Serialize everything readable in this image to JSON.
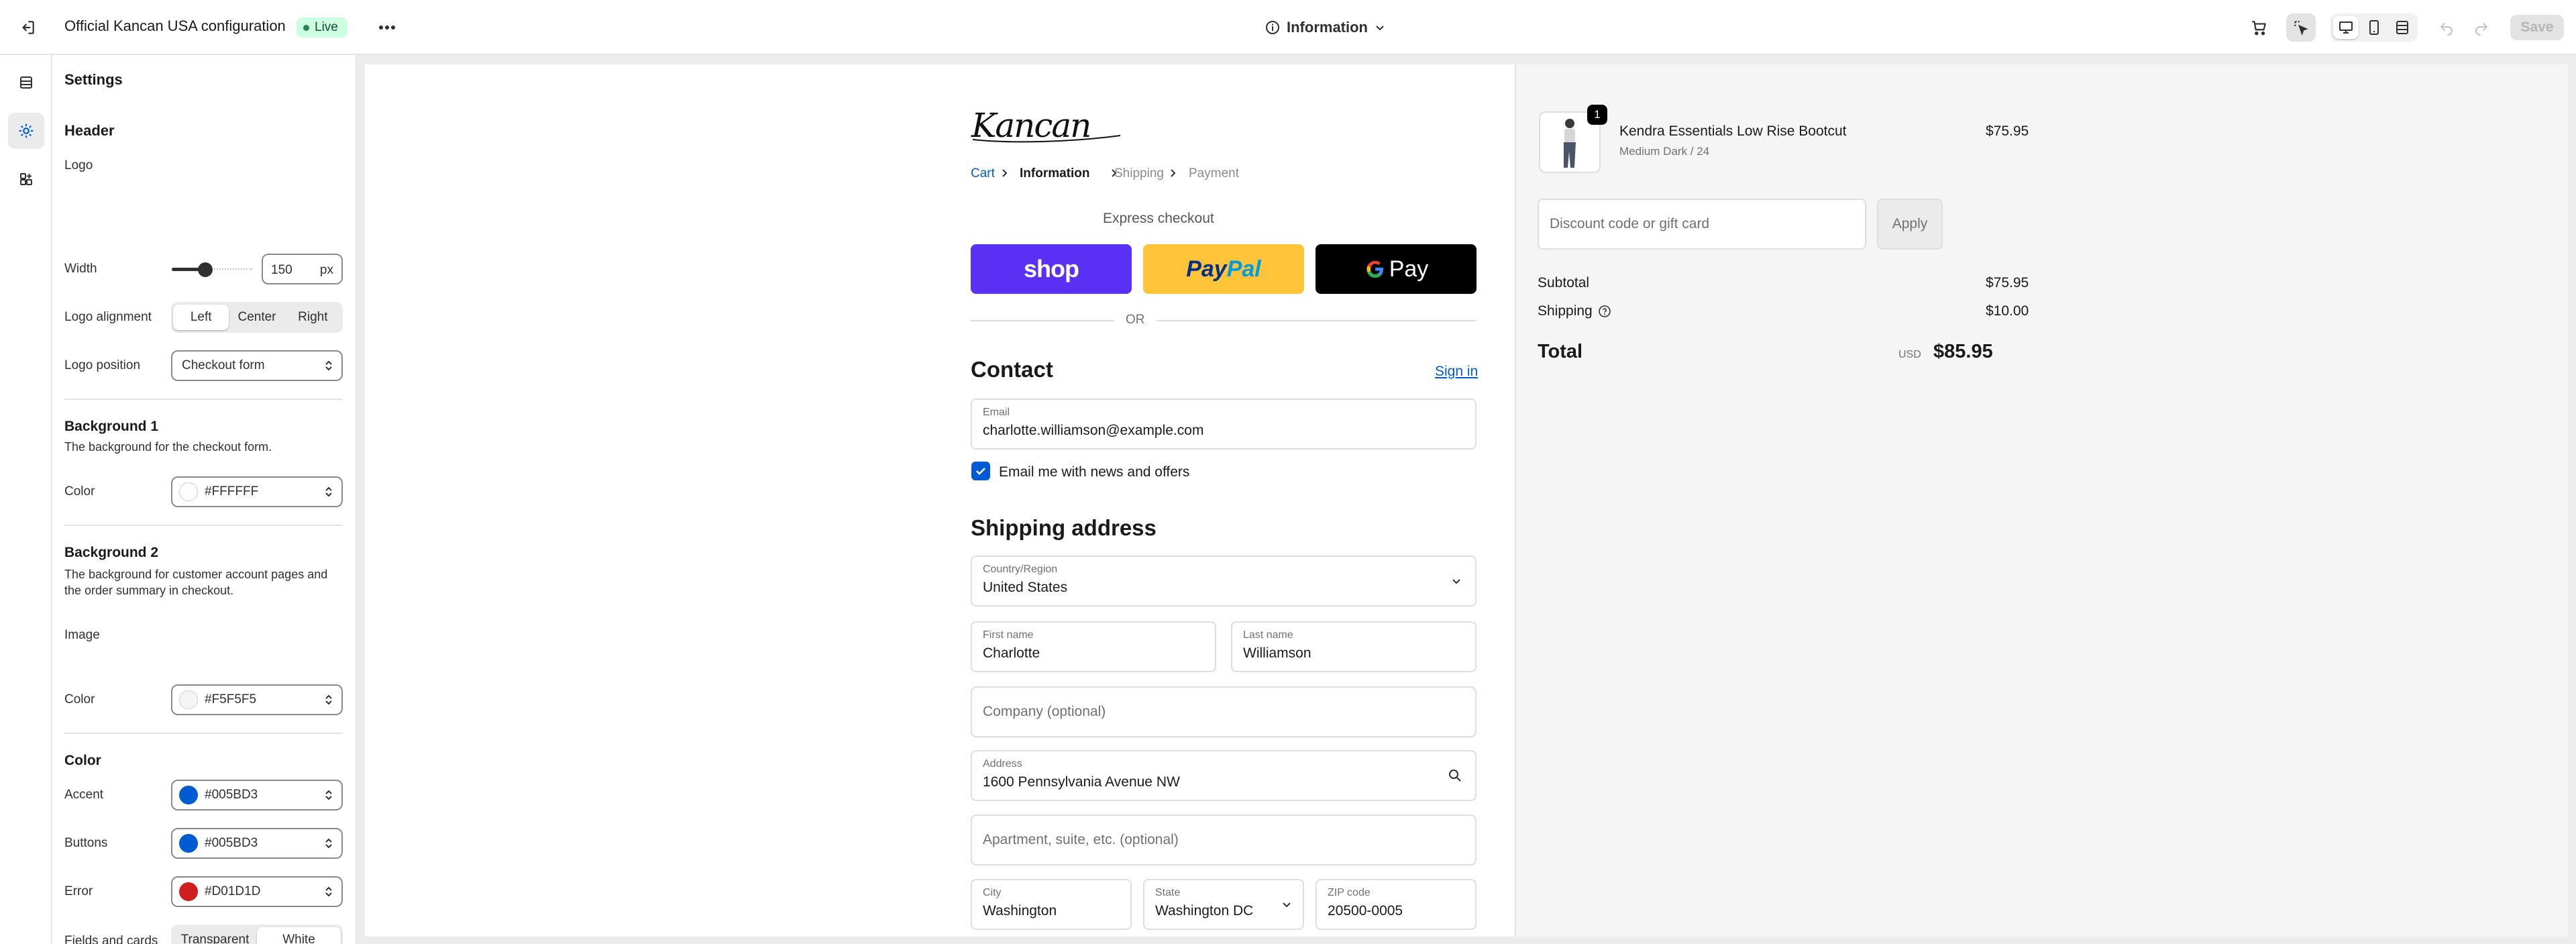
{
  "topbar": {
    "title": "Official Kancan USA configuration",
    "badge": "Live",
    "page_selector": "Information",
    "save_label": "Save"
  },
  "settings": {
    "title": "Settings",
    "header_section": "Header",
    "logo_label": "Logo",
    "width_label": "Width",
    "width_value": "150",
    "width_unit": "px",
    "width_slider_fraction": 0.42,
    "alignment_label": "Logo alignment",
    "alignment_options": [
      "Left",
      "Center",
      "Right"
    ],
    "alignment_selected": "Left",
    "position_label": "Logo position",
    "position_value": "Checkout form",
    "bg1_title": "Background 1",
    "bg1_help": "The background for the checkout form.",
    "bg1_color_label": "Color",
    "bg1_color_value": "#FFFFFF",
    "bg2_title": "Background 2",
    "bg2_help": "The background for customer account pages and the order summary in checkout.",
    "bg2_image_label": "Image",
    "bg2_color_label": "Color",
    "bg2_color_value": "#F5F5F5",
    "color_title": "Color",
    "accent_label": "Accent",
    "accent_value": "#005BD3",
    "buttons_label": "Buttons",
    "buttons_value": "#005BD3",
    "error_label": "Error",
    "error_value": "#D01D1D",
    "fields_label": "Fields and cards",
    "fields_options": [
      "Transparent",
      "White"
    ],
    "fields_selected": "White"
  },
  "colors": {
    "accent": "#005BD3",
    "error": "#D01D1D",
    "shop_pay": "#5A31F4",
    "paypal": "#FFC439",
    "gpay": "#000000",
    "live_badge_bg": "#CDFEE1"
  },
  "checkout": {
    "logo_text": "Kancan",
    "breadcrumbs": [
      "Cart",
      "Information",
      "Shipping",
      "Payment"
    ],
    "express_checkout": "Express checkout",
    "shop_label": "shop",
    "paypal_label_a": "Pay",
    "paypal_label_b": "Pal",
    "gpay_label": "Pay",
    "or_label": "OR",
    "contact_title": "Contact",
    "sign_in": "Sign in",
    "email_label": "Email",
    "email_value": "charlotte.williamson@example.com",
    "newsletter_label": "Email me with news and offers",
    "newsletter_checked": true,
    "shipping_title": "Shipping address",
    "country_label": "Country/Region",
    "country_value": "United States",
    "first_name_label": "First name",
    "first_name_value": "Charlotte",
    "last_name_label": "Last name",
    "last_name_value": "Williamson",
    "company_placeholder": "Company (optional)",
    "address_label": "Address",
    "address_value": "1600 Pennsylvania Avenue NW",
    "apartment_placeholder": "Apartment, suite, etc. (optional)",
    "city_label": "City",
    "city_value": "Washington",
    "state_label": "State",
    "state_value": "Washington DC",
    "zip_label": "ZIP code",
    "zip_value": "20500-0005"
  },
  "summary": {
    "product_name": "Kendra Essentials Low Rise Bootcut",
    "product_variant": "Medium Dark / 24",
    "product_qty": "1",
    "product_price": "$75.95",
    "discount_placeholder": "Discount code or gift card",
    "apply_label": "Apply",
    "subtotal_label": "Subtotal",
    "subtotal_value": "$75.95",
    "shipping_label": "Shipping",
    "shipping_value": "$10.00",
    "total_label": "Total",
    "currency": "USD",
    "total_value": "$85.95"
  }
}
